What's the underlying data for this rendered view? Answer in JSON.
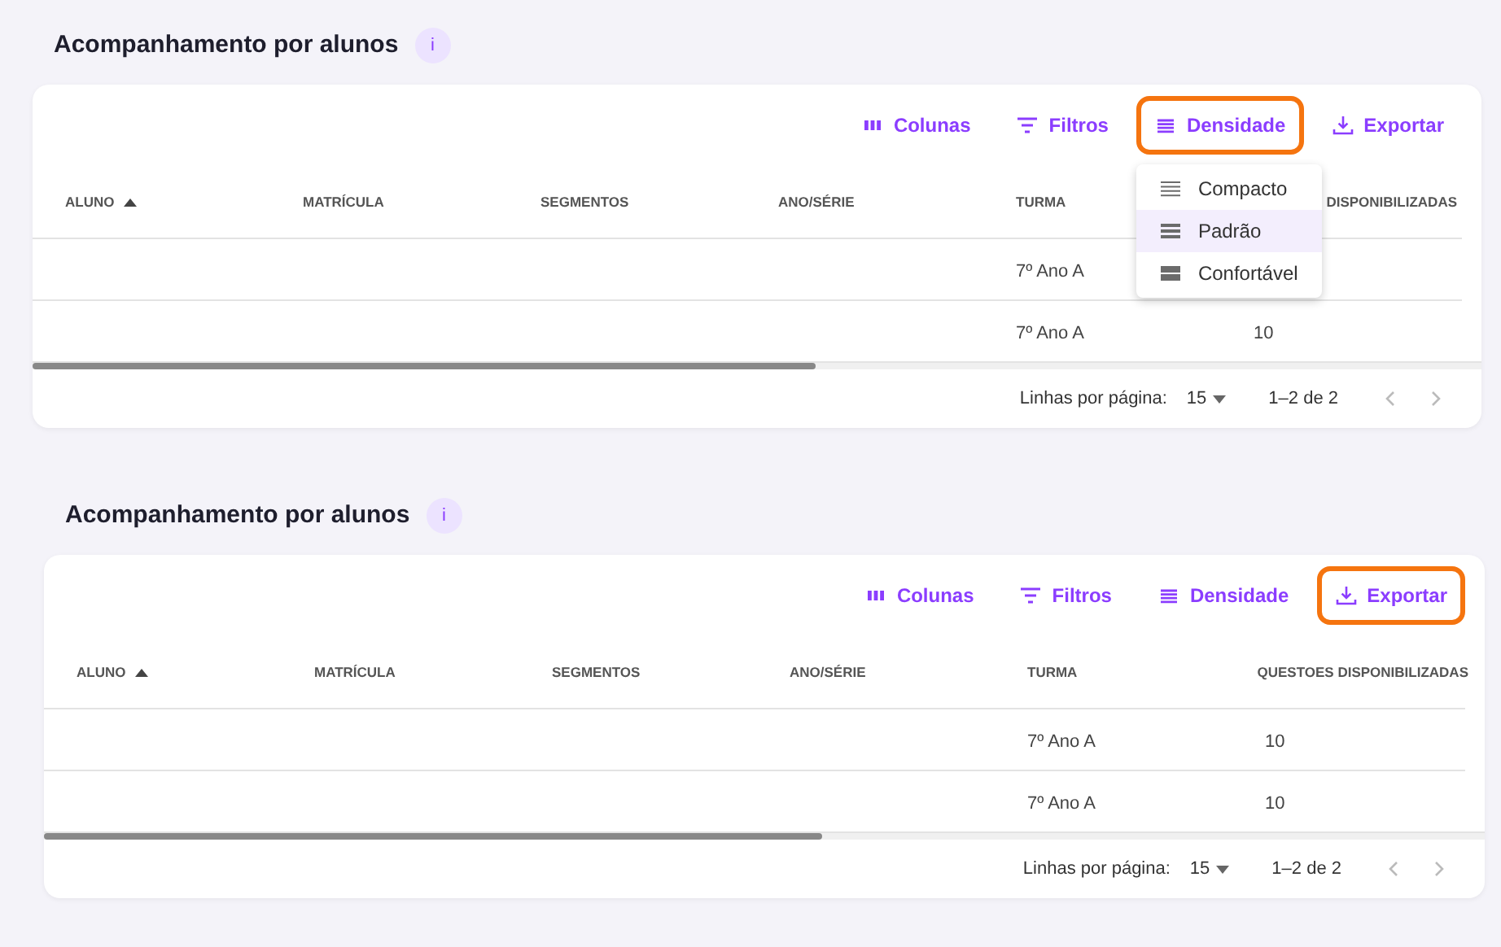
{
  "panels": [
    {
      "title": "Acompanhamento por alunos",
      "info_badge": "i",
      "toolbar": [
        {
          "kind": "columns",
          "label": "Colunas",
          "highlighted": false
        },
        {
          "kind": "filters",
          "label": "Filtros",
          "highlighted": false
        },
        {
          "kind": "density",
          "label": "Densidade",
          "highlighted": true
        },
        {
          "kind": "export",
          "label": "Exportar",
          "highlighted": false
        }
      ],
      "density_menu": {
        "items": [
          {
            "kind": "compact",
            "label": "Compacto",
            "selected": false
          },
          {
            "kind": "standard",
            "label": "Padrão",
            "selected": true
          },
          {
            "kind": "comfortable",
            "label": "Confortável",
            "selected": false
          }
        ]
      },
      "table": {
        "columns": [
          {
            "label": "ALUNO",
            "sorted": true
          },
          {
            "label": "MATRÍCULA",
            "sorted": false
          },
          {
            "label": "SEGMENTOS",
            "sorted": false
          },
          {
            "label": "ANO/SÉRIE",
            "sorted": false
          },
          {
            "label": "TURMA",
            "sorted": false
          },
          {
            "label": "DISPONIBILIZADAS",
            "sorted": false
          }
        ],
        "rows": [
          {
            "turma": "7º Ano A"
          },
          {
            "turma": "7º Ano A",
            "questoes_disponibilizadas": "10"
          }
        ]
      },
      "footer": {
        "rows_per_page_label": "Linhas por página:",
        "rows_per_page": "15",
        "range": "1–2 de 2"
      }
    },
    {
      "title": "Acompanhamento por alunos",
      "info_badge": "i",
      "toolbar": [
        {
          "kind": "columns",
          "label": "Colunas",
          "highlighted": false
        },
        {
          "kind": "filters",
          "label": "Filtros",
          "highlighted": false
        },
        {
          "kind": "density",
          "label": "Densidade",
          "highlighted": false
        },
        {
          "kind": "export",
          "label": "Exportar",
          "highlighted": true
        }
      ],
      "table": {
        "columns": [
          {
            "label": "ALUNO",
            "sorted": true
          },
          {
            "label": "MATRÍCULA",
            "sorted": false
          },
          {
            "label": "SEGMENTOS",
            "sorted": false
          },
          {
            "label": "ANO/SÉRIE",
            "sorted": false
          },
          {
            "label": "TURMA",
            "sorted": false
          },
          {
            "label": "QUESTOES DISPONIBILIZADAS",
            "sorted": false
          }
        ],
        "rows": [
          {
            "turma": "7º Ano A",
            "questoes_disponibilizadas": "10"
          },
          {
            "turma": "7º Ano A",
            "questoes_disponibilizadas": "10"
          }
        ]
      },
      "footer": {
        "rows_per_page_label": "Linhas por página:",
        "rows_per_page": "15",
        "range": "1–2 de 2"
      }
    }
  ]
}
